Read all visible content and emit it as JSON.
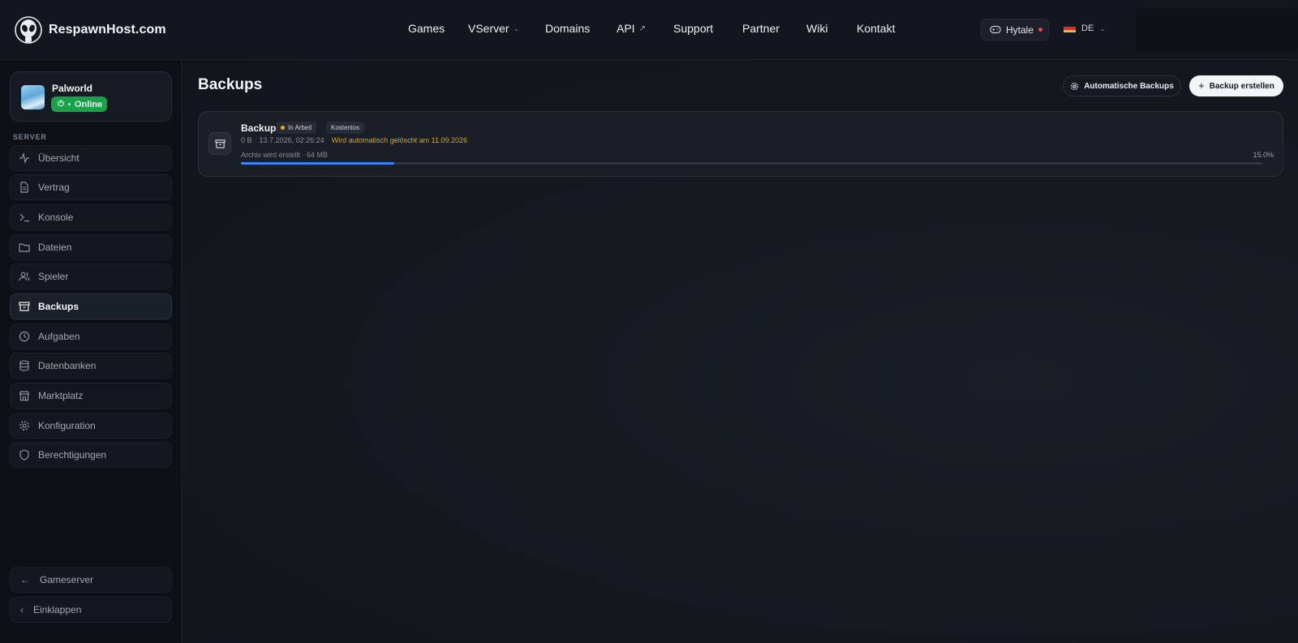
{
  "brand": {
    "name": "RespawnHost.com"
  },
  "nav": {
    "items": [
      {
        "label": "Games"
      },
      {
        "label": "VServer",
        "suffix": "⌄"
      },
      {
        "label": "Domains"
      },
      {
        "label": "API",
        "suffix": "↗"
      },
      {
        "label": "Support"
      },
      {
        "label": "Partner"
      },
      {
        "label": "Wiki"
      },
      {
        "label": "Kontakt"
      }
    ],
    "game_selector": {
      "label": "Hytale",
      "status_color": "#e5484d"
    },
    "language": {
      "code": "DE"
    }
  },
  "sidebar": {
    "server": {
      "name": "Palworld",
      "status": "Online",
      "status_color": "#16a34a"
    },
    "section_label": "SERVER",
    "items": [
      {
        "label": "Übersicht",
        "icon": "activity-icon"
      },
      {
        "label": "Vertrag",
        "icon": "document-icon"
      },
      {
        "label": "Konsole",
        "icon": "terminal-icon"
      },
      {
        "label": "Dateien",
        "icon": "folder-icon"
      },
      {
        "label": "Spieler",
        "icon": "users-icon"
      },
      {
        "label": "Backups",
        "icon": "archive-icon",
        "active": true
      },
      {
        "label": "Aufgaben",
        "icon": "clock-icon"
      },
      {
        "label": "Datenbanken",
        "icon": "database-icon"
      },
      {
        "label": "Marktplatz",
        "icon": "store-icon"
      },
      {
        "label": "Konfiguration",
        "icon": "gear-icon"
      },
      {
        "label": "Berechtigungen",
        "icon": "shield-icon"
      }
    ],
    "bottom": [
      {
        "label": "Gameserver",
        "icon": "arrow-left-icon"
      },
      {
        "label": "Einklappen",
        "icon": "chevron-left-icon"
      }
    ]
  },
  "main": {
    "title": "Backups",
    "auto_backups_label": "Automatische Backups",
    "create_backup_label": "Backup erstellen",
    "backups": [
      {
        "name": "Backup",
        "status": "In Arbeit",
        "tag": "Kostenlos",
        "size": "0 B",
        "created": "13.7.2026, 02:26:24",
        "auto_delete": "Wird automatisch gelöscht am 11.09.2026",
        "progress_text": "Archiv wird erstellt · 64 MB",
        "progress_label": "15.0%",
        "progress": 0.15
      }
    ]
  },
  "colors": {
    "accent": "#3b82f6",
    "online": "#16a34a",
    "warning": "#d9a51a",
    "status_dot": "#e0b11a"
  }
}
